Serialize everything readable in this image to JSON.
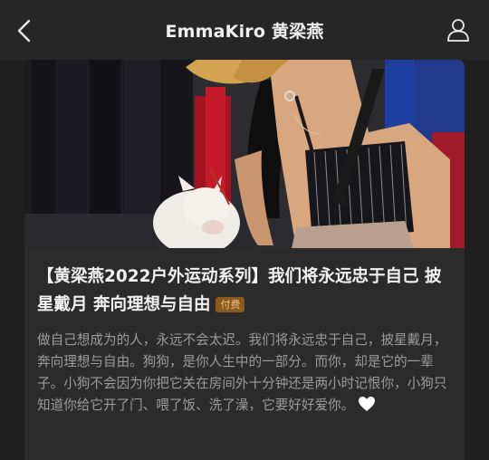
{
  "header": {
    "title": "EmmaKiro 黄梁燕",
    "back_icon": "chevron-left-icon",
    "profile_icon": "person-icon"
  },
  "article": {
    "title": "【黄梁燕2022户外运动系列】我们将永远忠于自己 披星戴月 奔向理想与自由",
    "paid_badge": "付费",
    "excerpt": "做自己想成为的人，永远不会太迟。我们将永远忠于自己，披星戴月，奔向理想与自由。狗狗，是你人生中的一部分。而你，却是它的一辈子。小狗不会因为你把它关在房间外十分钟还是两小时记恨你，小狗只知道你给它开了门、喂了饭、洗了澡，它要好好爱你。",
    "excerpt_end_icon": "white-heart-icon"
  },
  "colors": {
    "background": "#1f1f1f",
    "card": "#2b2b2b",
    "badge_bg": "#8a5a1c",
    "badge_text": "#f3c07a"
  }
}
